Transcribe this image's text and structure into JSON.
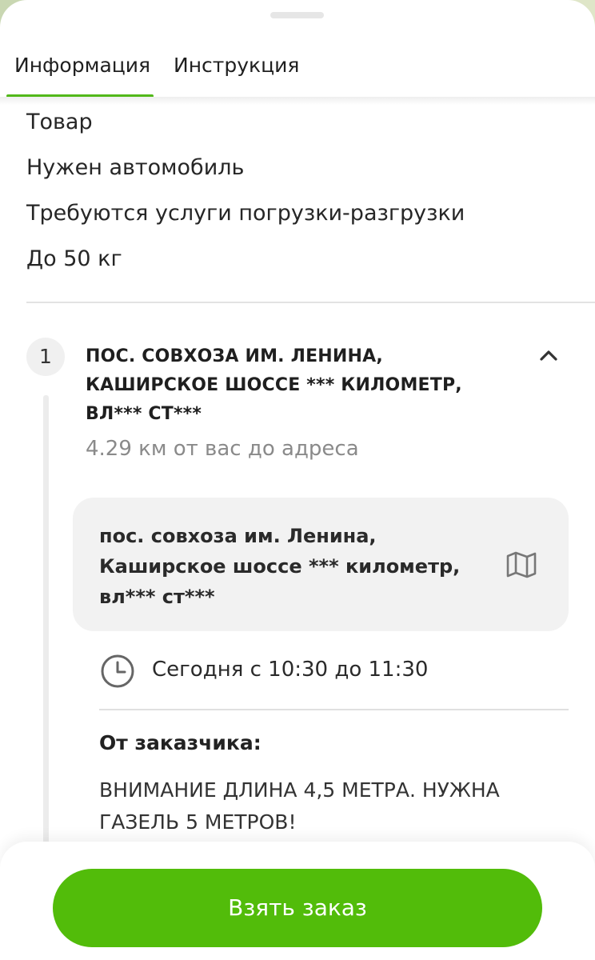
{
  "tabs": [
    {
      "label": "Информация"
    },
    {
      "label": "Инструкция"
    }
  ],
  "info": {
    "lines": [
      "Товар",
      "Нужен автомобиль",
      "Требуются услуги погрузки-разгрузки",
      "До 50 кг"
    ]
  },
  "route": {
    "step_number": "1",
    "title": "ПОС. СОВХОЗА ИМ. ЛЕНИНА, КАШИРСКОЕ ШОССЕ *** КИЛОМЕТР, ВЛ*** СТ***",
    "distance": "4.29 км от вас до адреса",
    "address_card": "пос. совхоза им. Ленина, Каширское шоссе *** километр, вл*** ст***",
    "time": "Сегодня с 10:30 до 11:30",
    "from_customer_label": "От заказчика:",
    "comment": "ВНИМАНИЕ ДЛИНА 4,5 МЕТРА. НУЖНА ГАЗЕЛЬ 5 МЕТРОВ!"
  },
  "action": {
    "take_order_label": "Взять заказ"
  },
  "icons": {
    "chevron": "chevron-up-icon",
    "map": "map-icon",
    "clock": "clock-icon"
  },
  "colors": {
    "accent": "#52bc0a",
    "tab_underline": "#52b81a"
  }
}
